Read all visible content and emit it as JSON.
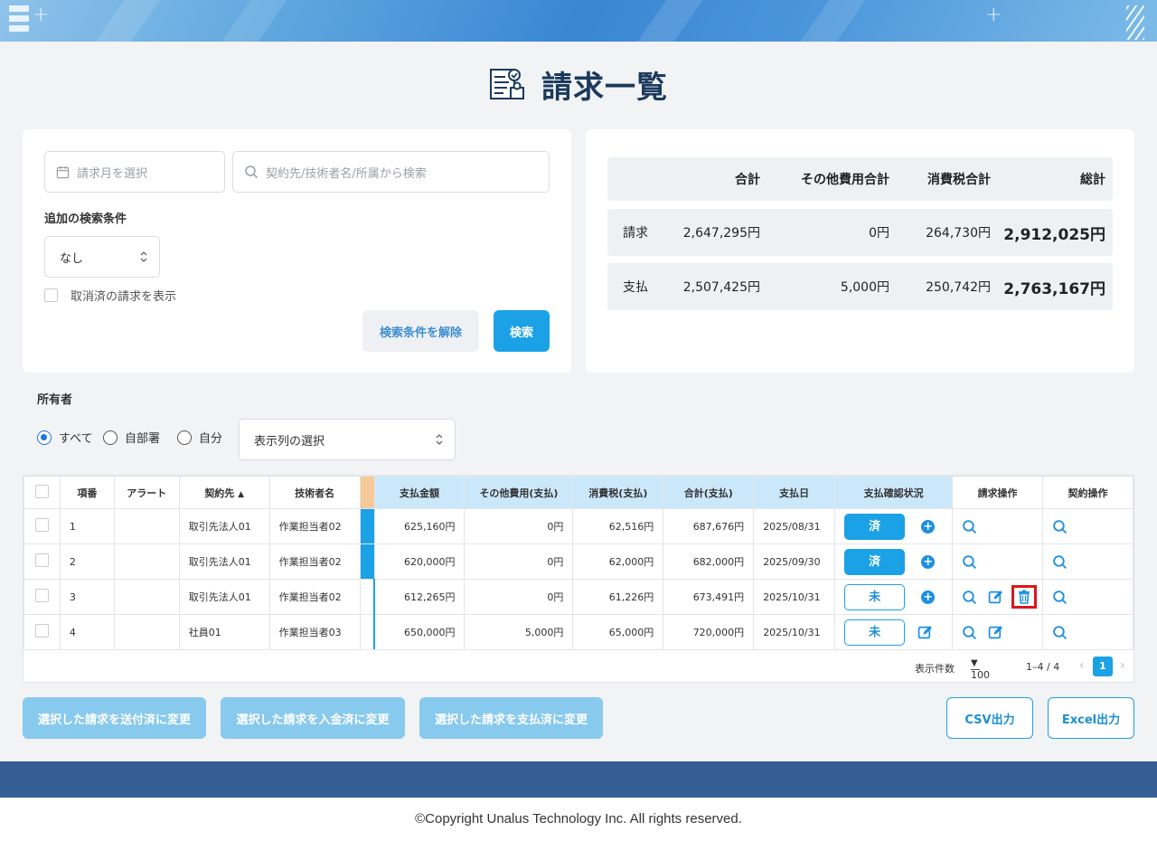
{
  "page": {
    "title": "請求一覧"
  },
  "search": {
    "month_placeholder": "請求月を選択",
    "keyword_placeholder": "契約先/技術者名/所属から検索",
    "additional_label": "追加の検索条件",
    "additional_value": "なし",
    "show_cancelled_label": "取消済の請求を表示",
    "clear_label": "検索条件を解除",
    "search_label": "検索"
  },
  "totals": {
    "headers": [
      "合計",
      "その他費用合計",
      "消費税合計",
      "総計"
    ],
    "rows": [
      {
        "label": "請求",
        "total": "2,647,295円",
        "other": "0円",
        "tax": "264,730円",
        "grand": "2,912,025円"
      },
      {
        "label": "支払",
        "total": "2,507,425円",
        "other": "5,000円",
        "tax": "250,742円",
        "grand": "2,763,167円"
      }
    ]
  },
  "owner": {
    "label": "所有者",
    "options": [
      "すべて",
      "自部署",
      "自分"
    ],
    "selected": "すべて",
    "columns_select": "表示列の選択"
  },
  "table": {
    "headers": {
      "no": "項番",
      "alert": "アラート",
      "client": "契約先",
      "engineer": "技術者名",
      "pay_amount": "支払金額",
      "other_cost": "その他費用(支払)",
      "tax": "消費税(支払)",
      "total": "合計(支払)",
      "pay_date": "支払日",
      "pay_status": "支払確認状況",
      "invoice_ops": "請求操作",
      "contract_ops": "契約操作"
    },
    "rows": [
      {
        "no": "1",
        "client": "取引先法人01",
        "engineer": "作業担当者02",
        "pay_amount": "625,160円",
        "other_cost": "0円",
        "tax": "62,516円",
        "total": "687,676円",
        "pay_date": "2025/08/31",
        "status": "済"
      },
      {
        "no": "2",
        "client": "取引先法人01",
        "engineer": "作業担当者02",
        "pay_amount": "620,000円",
        "other_cost": "0円",
        "tax": "62,000円",
        "total": "682,000円",
        "pay_date": "2025/09/30",
        "status": "済"
      },
      {
        "no": "3",
        "client": "取引先法人01",
        "engineer": "作業担当者02",
        "pay_amount": "612,265円",
        "other_cost": "0円",
        "tax": "61,226円",
        "total": "673,491円",
        "pay_date": "2025/10/31",
        "status": "未"
      },
      {
        "no": "4",
        "client": "社員01",
        "engineer": "作業担当者03",
        "pay_amount": "650,000円",
        "other_cost": "5,000円",
        "tax": "65,000円",
        "total": "720,000円",
        "pay_date": "2025/10/31",
        "status": "未"
      }
    ],
    "pager": {
      "per_page_label": "表示件数",
      "per_page": "100",
      "range": "1–4 / 4",
      "page": "1"
    }
  },
  "actions": {
    "sent": "選択した請求を送付済に変更",
    "received": "選択した請求を入金済に変更",
    "paid": "選択した請求を支払済に変更",
    "csv": "CSV出力",
    "excel": "Excel出力"
  },
  "footer": {
    "copyright": "©Copyright Unalus Technology Inc. All rights reserved."
  },
  "colors": {
    "accent": "#1ba1e6",
    "header_blue": "#cbe8fb",
    "footer_band": "#355e94",
    "highlight": "#e0141b"
  }
}
